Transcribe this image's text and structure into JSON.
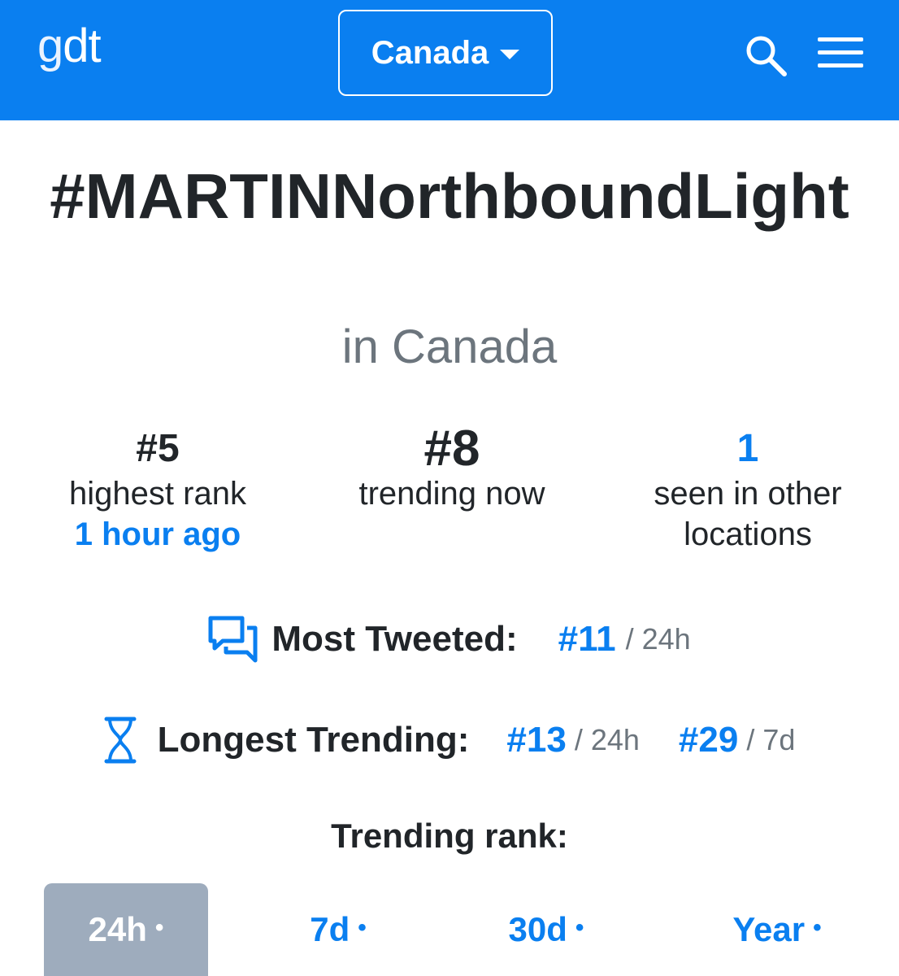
{
  "header": {
    "logo_g": "g",
    "logo_dt": "dt",
    "country": "Canada",
    "search_icon": "search-icon",
    "menu_icon": "hamburger-menu-icon",
    "bg_color": "#0a7ff0"
  },
  "hashtag": {
    "title": "#MARTINNorthboundLight",
    "location": "in Canada"
  },
  "stats": {
    "highest_rank": {
      "value": "#5",
      "label": "highest rank",
      "when": "1 hour ago"
    },
    "trending_now": {
      "value": "#8",
      "label": "trending now"
    },
    "other_locations": {
      "value": "1",
      "label_line1": "seen in other",
      "label_line2": "locations"
    }
  },
  "most_tweeted": {
    "label": "Most Tweeted:",
    "rank": "#11",
    "period": "/ 24h",
    "icon": "chat-bubbles-icon"
  },
  "longest_trending": {
    "label": "Longest Trending:",
    "rank_24h": "#13",
    "period_24h": "/ 24h",
    "rank_7d": "#29",
    "period_7d": "/ 7d",
    "icon": "hourglass-icon"
  },
  "trending_rank": {
    "label": "Trending rank:",
    "tabs": [
      {
        "label": "24h",
        "dot": "•"
      },
      {
        "label": "7d",
        "dot": "•"
      },
      {
        "label": "30d",
        "dot": "•"
      },
      {
        "label": "Year",
        "dot": "•"
      }
    ],
    "active_tab": "24h"
  },
  "colors": {
    "accent": "#0a7ff0",
    "muted": "#6c757d",
    "active_tab_bg": "#9eacbd"
  }
}
